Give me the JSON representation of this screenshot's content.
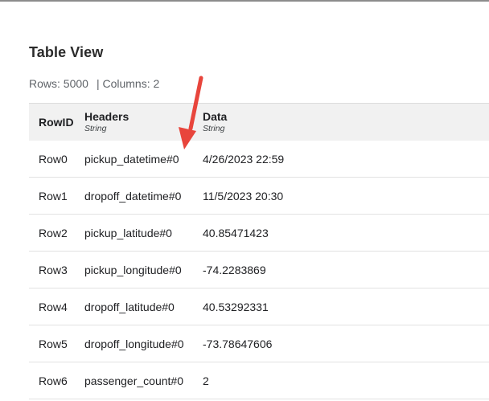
{
  "title": "Table View",
  "summary": {
    "rows": "Rows: 5000",
    "columns": "| Columns: 2"
  },
  "table": {
    "headers": [
      {
        "label": "RowID",
        "type": ""
      },
      {
        "label": "Headers",
        "type": "String"
      },
      {
        "label": "Data",
        "type": "String"
      }
    ],
    "rows": [
      [
        "Row0",
        "pickup_datetime#0",
        "4/26/2023 22:59"
      ],
      [
        "Row1",
        "dropoff_datetime#0",
        "11/5/2023 20:30"
      ],
      [
        "Row2",
        "pickup_latitude#0",
        "40.85471423"
      ],
      [
        "Row3",
        "pickup_longitude#0",
        "-74.2283869"
      ],
      [
        "Row4",
        "dropoff_latitude#0",
        "40.53292331"
      ],
      [
        "Row5",
        "dropoff_longitude#0",
        "-73.78647606"
      ],
      [
        "Row6",
        "passenger_count#0",
        "2"
      ]
    ]
  },
  "colors": {
    "annotation_arrow": "#e8453c"
  }
}
